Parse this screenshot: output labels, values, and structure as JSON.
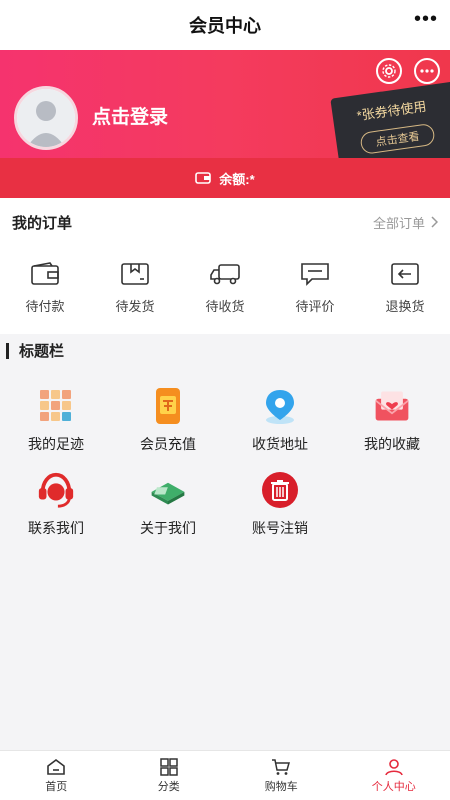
{
  "header": {
    "title": "会员中心",
    "more": "•••"
  },
  "profile": {
    "login_text": "点击登录"
  },
  "coupon": {
    "count_text": "*张券待使用",
    "view_text": "点击查看"
  },
  "balance": {
    "label": "余额:*"
  },
  "orders": {
    "title": "我的订单",
    "all_label": "全部订单",
    "items": [
      {
        "label": "待付款"
      },
      {
        "label": "待发货"
      },
      {
        "label": "待收货"
      },
      {
        "label": "待评价"
      },
      {
        "label": "退换货"
      }
    ]
  },
  "section": {
    "title": "标题栏"
  },
  "services": [
    {
      "label": "我的足迹"
    },
    {
      "label": "会员充值"
    },
    {
      "label": "收货地址"
    },
    {
      "label": "我的收藏"
    },
    {
      "label": "联系我们"
    },
    {
      "label": "关于我们"
    },
    {
      "label": "账号注销"
    }
  ],
  "tabbar": {
    "items": [
      {
        "label": "首页"
      },
      {
        "label": "分类"
      },
      {
        "label": "购物车"
      },
      {
        "label": "个人中心"
      }
    ]
  },
  "colors": {
    "brand": "#f43b5e",
    "active_tab": "#e52a3d"
  }
}
